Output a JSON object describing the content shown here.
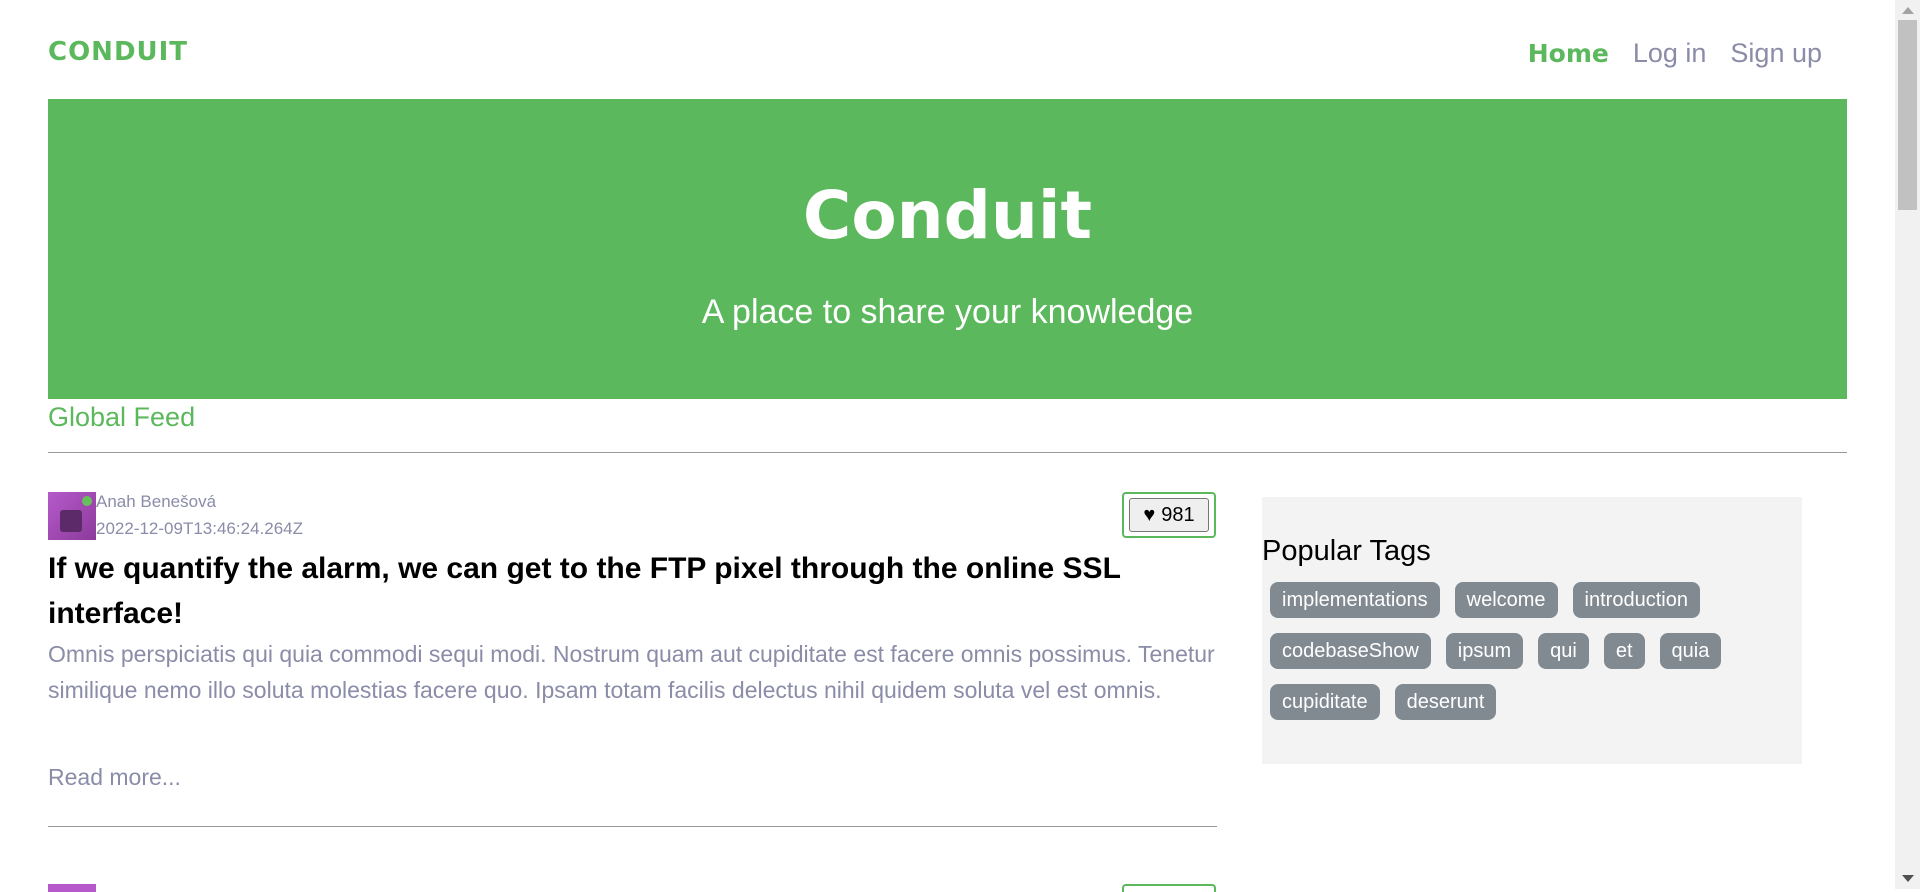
{
  "navbar": {
    "brand": "CONDUIT",
    "links": [
      {
        "label": "Home",
        "active": true
      },
      {
        "label": "Log in",
        "active": false
      },
      {
        "label": "Sign up",
        "active": false
      }
    ]
  },
  "banner": {
    "title": "Conduit",
    "subtitle": "A place to share your knowledge"
  },
  "feed": {
    "tab_label": "Global Feed"
  },
  "articles": [
    {
      "author": "Anah Benešová",
      "date": "2022-12-09T13:46:24.264Z",
      "favorite_icon": "♥",
      "favorites_count": "981",
      "title": "If we quantify the alarm, we can get to the FTP pixel through the online SSL interface!",
      "description": "Omnis perspiciatis qui quia commodi sequi modi. Nostrum quam aut cupiditate est facere omnis possimus. Tenetur similique nemo illo soluta molestias facere quo. Ipsam totam facilis delectus nihil quidem soluta vel est omnis.",
      "read_more": "Read more..."
    }
  ],
  "sidebar": {
    "title": "Popular Tags",
    "tags": [
      "implementations",
      "welcome",
      "introduction",
      "codebaseShow",
      "ipsum",
      "qui",
      "et",
      "quia",
      "cupiditate",
      "deserunt"
    ]
  },
  "colors": {
    "accent": "#5cb85c",
    "muted_text": "#8a8ca8",
    "tag_bg": "#818a91",
    "sidebar_bg": "#f3f3f3"
  }
}
